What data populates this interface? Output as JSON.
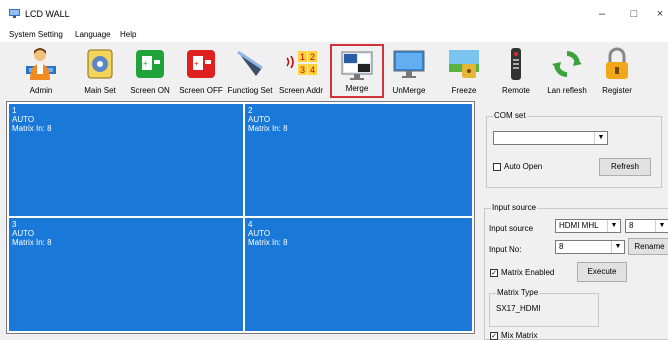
{
  "window": {
    "title": "LCD WALL"
  },
  "menu": [
    "System Setting",
    "Language",
    "Help"
  ],
  "toolbar": [
    {
      "label": "Admin",
      "icon": "admin-icon"
    },
    {
      "label": "Main Set",
      "icon": "main-set-icon"
    },
    {
      "label": "Screen ON",
      "icon": "screen-on-icon"
    },
    {
      "label": "Screen OFF",
      "icon": "screen-off-icon"
    },
    {
      "label": "Functiog Set",
      "icon": "function-set-icon"
    },
    {
      "label": "Screen Addr",
      "icon": "screen-addr-icon"
    },
    {
      "label": "Merge",
      "icon": "merge-icon",
      "selected": true
    },
    {
      "label": "UnMerge",
      "icon": "unmerge-icon"
    },
    {
      "label": "Freeze",
      "icon": "freeze-icon"
    },
    {
      "label": "Remote",
      "icon": "remote-icon"
    },
    {
      "label": "Lan reflesh",
      "icon": "lan-refresh-icon"
    },
    {
      "label": "Register",
      "icon": "register-icon"
    }
  ],
  "screens": [
    {
      "num": "1",
      "mode": "AUTO",
      "matrix": "Matrix In: 8"
    },
    {
      "num": "2",
      "mode": "AUTO",
      "matrix": "Matrix In: 8"
    },
    {
      "num": "3",
      "mode": "AUTO",
      "matrix": "Matrix In: 8"
    },
    {
      "num": "4",
      "mode": "AUTO",
      "matrix": "Matrix In: 8"
    }
  ],
  "com_set": {
    "title": "COM set",
    "port_value": "",
    "auto_open_label": "Auto Open",
    "auto_open_checked": false,
    "refresh_label": "Refresh"
  },
  "input_source": {
    "title": "Input source",
    "source_label": "Input source",
    "source_value": "HDMI MHL",
    "source_num": "8",
    "input_no_label": "Input No:",
    "input_no_value": "8",
    "rename_label": "Rename",
    "matrix_enabled_label": "Matrix Enabled",
    "matrix_enabled_checked": true,
    "execute_label": "Execute",
    "matrix_type_title": "Matrix Type",
    "matrix_type_value": "SX17_HDMI",
    "mix_matrix_label": "Mix Matrix",
    "mix_matrix_checked": true
  },
  "colors": {
    "screen_blue": "#1a78d8",
    "selected_border": "#d0333a"
  }
}
